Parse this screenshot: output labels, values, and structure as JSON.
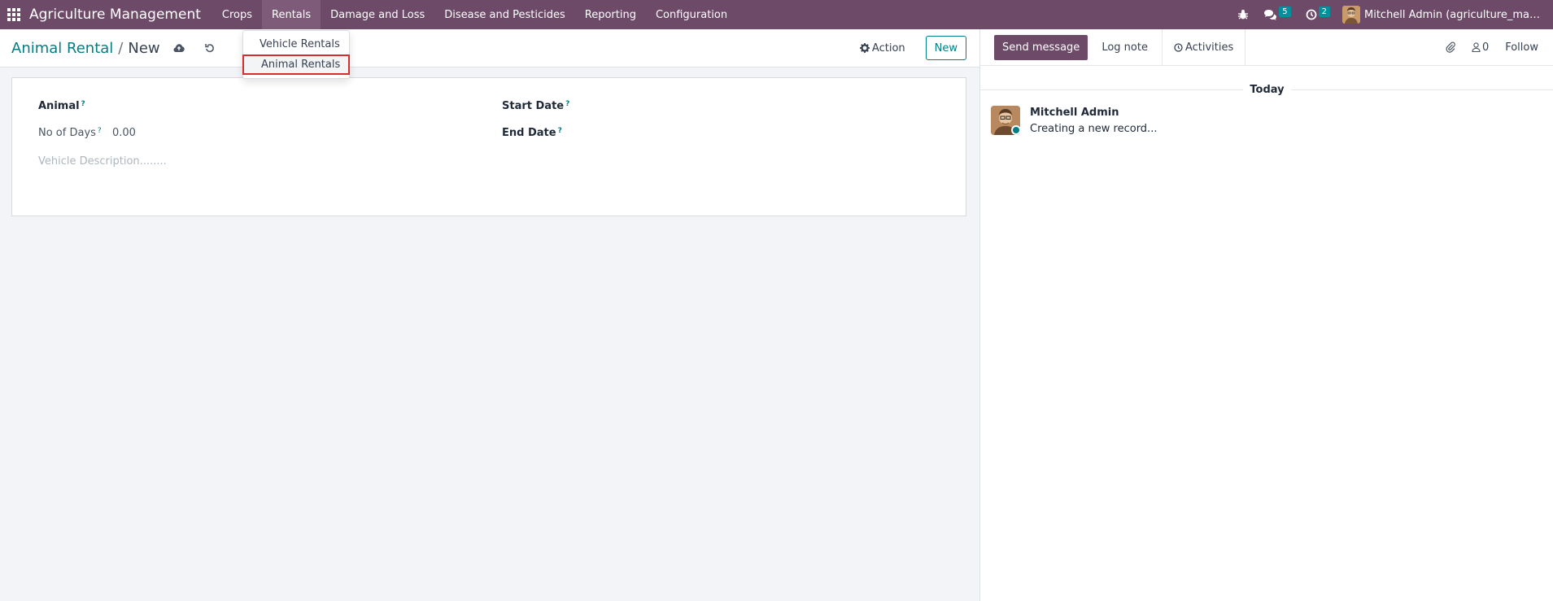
{
  "navbar": {
    "app_name": "Agriculture Management",
    "menu": [
      {
        "label": "Crops"
      },
      {
        "label": "Rentals"
      },
      {
        "label": "Damage and Loss"
      },
      {
        "label": "Disease and Pesticides"
      },
      {
        "label": "Reporting"
      },
      {
        "label": "Configuration"
      }
    ],
    "messages_count": "5",
    "activities_count": "2",
    "user_name": "Mitchell Admin (agriculture_managem..."
  },
  "rentals_dropdown": {
    "items": [
      {
        "label": "Vehicle Rentals"
      },
      {
        "label": "Animal Rentals",
        "highlighted": true
      }
    ]
  },
  "control_panel": {
    "breadcrumb_parent": "Animal Rental",
    "breadcrumb_separator": "/",
    "breadcrumb_current": "New",
    "action_label": "Action",
    "new_label": "New"
  },
  "form": {
    "animal_label": "Animal",
    "start_date_label": "Start Date",
    "no_of_days_label": "No of Days",
    "no_of_days_value": "0.00",
    "end_date_label": "End Date",
    "description_placeholder": "Vehicle Description........",
    "help_marker": "?"
  },
  "chatter": {
    "send_message_label": "Send message",
    "log_note_label": "Log note",
    "activities_label": "Activities",
    "followers_count": "0",
    "follow_label": "Follow",
    "date_separator": "Today",
    "message": {
      "author": "Mitchell Admin",
      "body": "Creating a new record..."
    }
  },
  "colors": {
    "navbar": "#6c4a68",
    "accent_teal": "#017e84",
    "highlight_box": "#d32f2f"
  }
}
